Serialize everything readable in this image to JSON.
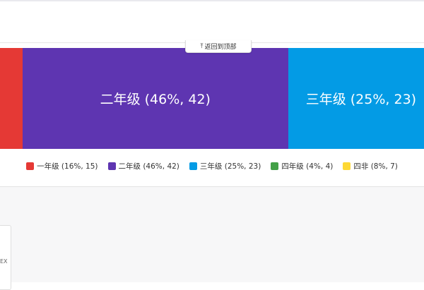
{
  "back_to_top": {
    "label": "返回到顶部",
    "icon": "arrow-up-bar-icon"
  },
  "chart_data": {
    "type": "bar",
    "orientation": "horizontal-stacked",
    "categories": [
      "一年级",
      "二年级",
      "三年级",
      "四年级",
      "四非"
    ],
    "values": [
      15,
      42,
      23,
      4,
      7
    ],
    "percents": [
      16,
      46,
      25,
      4,
      8
    ],
    "colors": [
      "#e53935",
      "#5e35b1",
      "#039be5",
      "#43a047",
      "#fdd835"
    ],
    "segment_labels": [
      "",
      "二年级 (46%, 42)",
      "三年级 (25%, 23)",
      "",
      ""
    ],
    "view_range": [
      12.6,
      86.2
    ]
  },
  "legend": [
    {
      "label": "一年级 (16%, 15)",
      "color": "#e53935"
    },
    {
      "label": "二年级 (46%, 42)",
      "color": "#5e35b1"
    },
    {
      "label": "三年级 (25%, 23)",
      "color": "#039be5"
    },
    {
      "label": "四年级 (4%, 4)",
      "color": "#43a047"
    },
    {
      "label": "四非 (8%, 7)",
      "color": "#fdd835"
    }
  ],
  "lower": {
    "cut_text": "EX"
  }
}
